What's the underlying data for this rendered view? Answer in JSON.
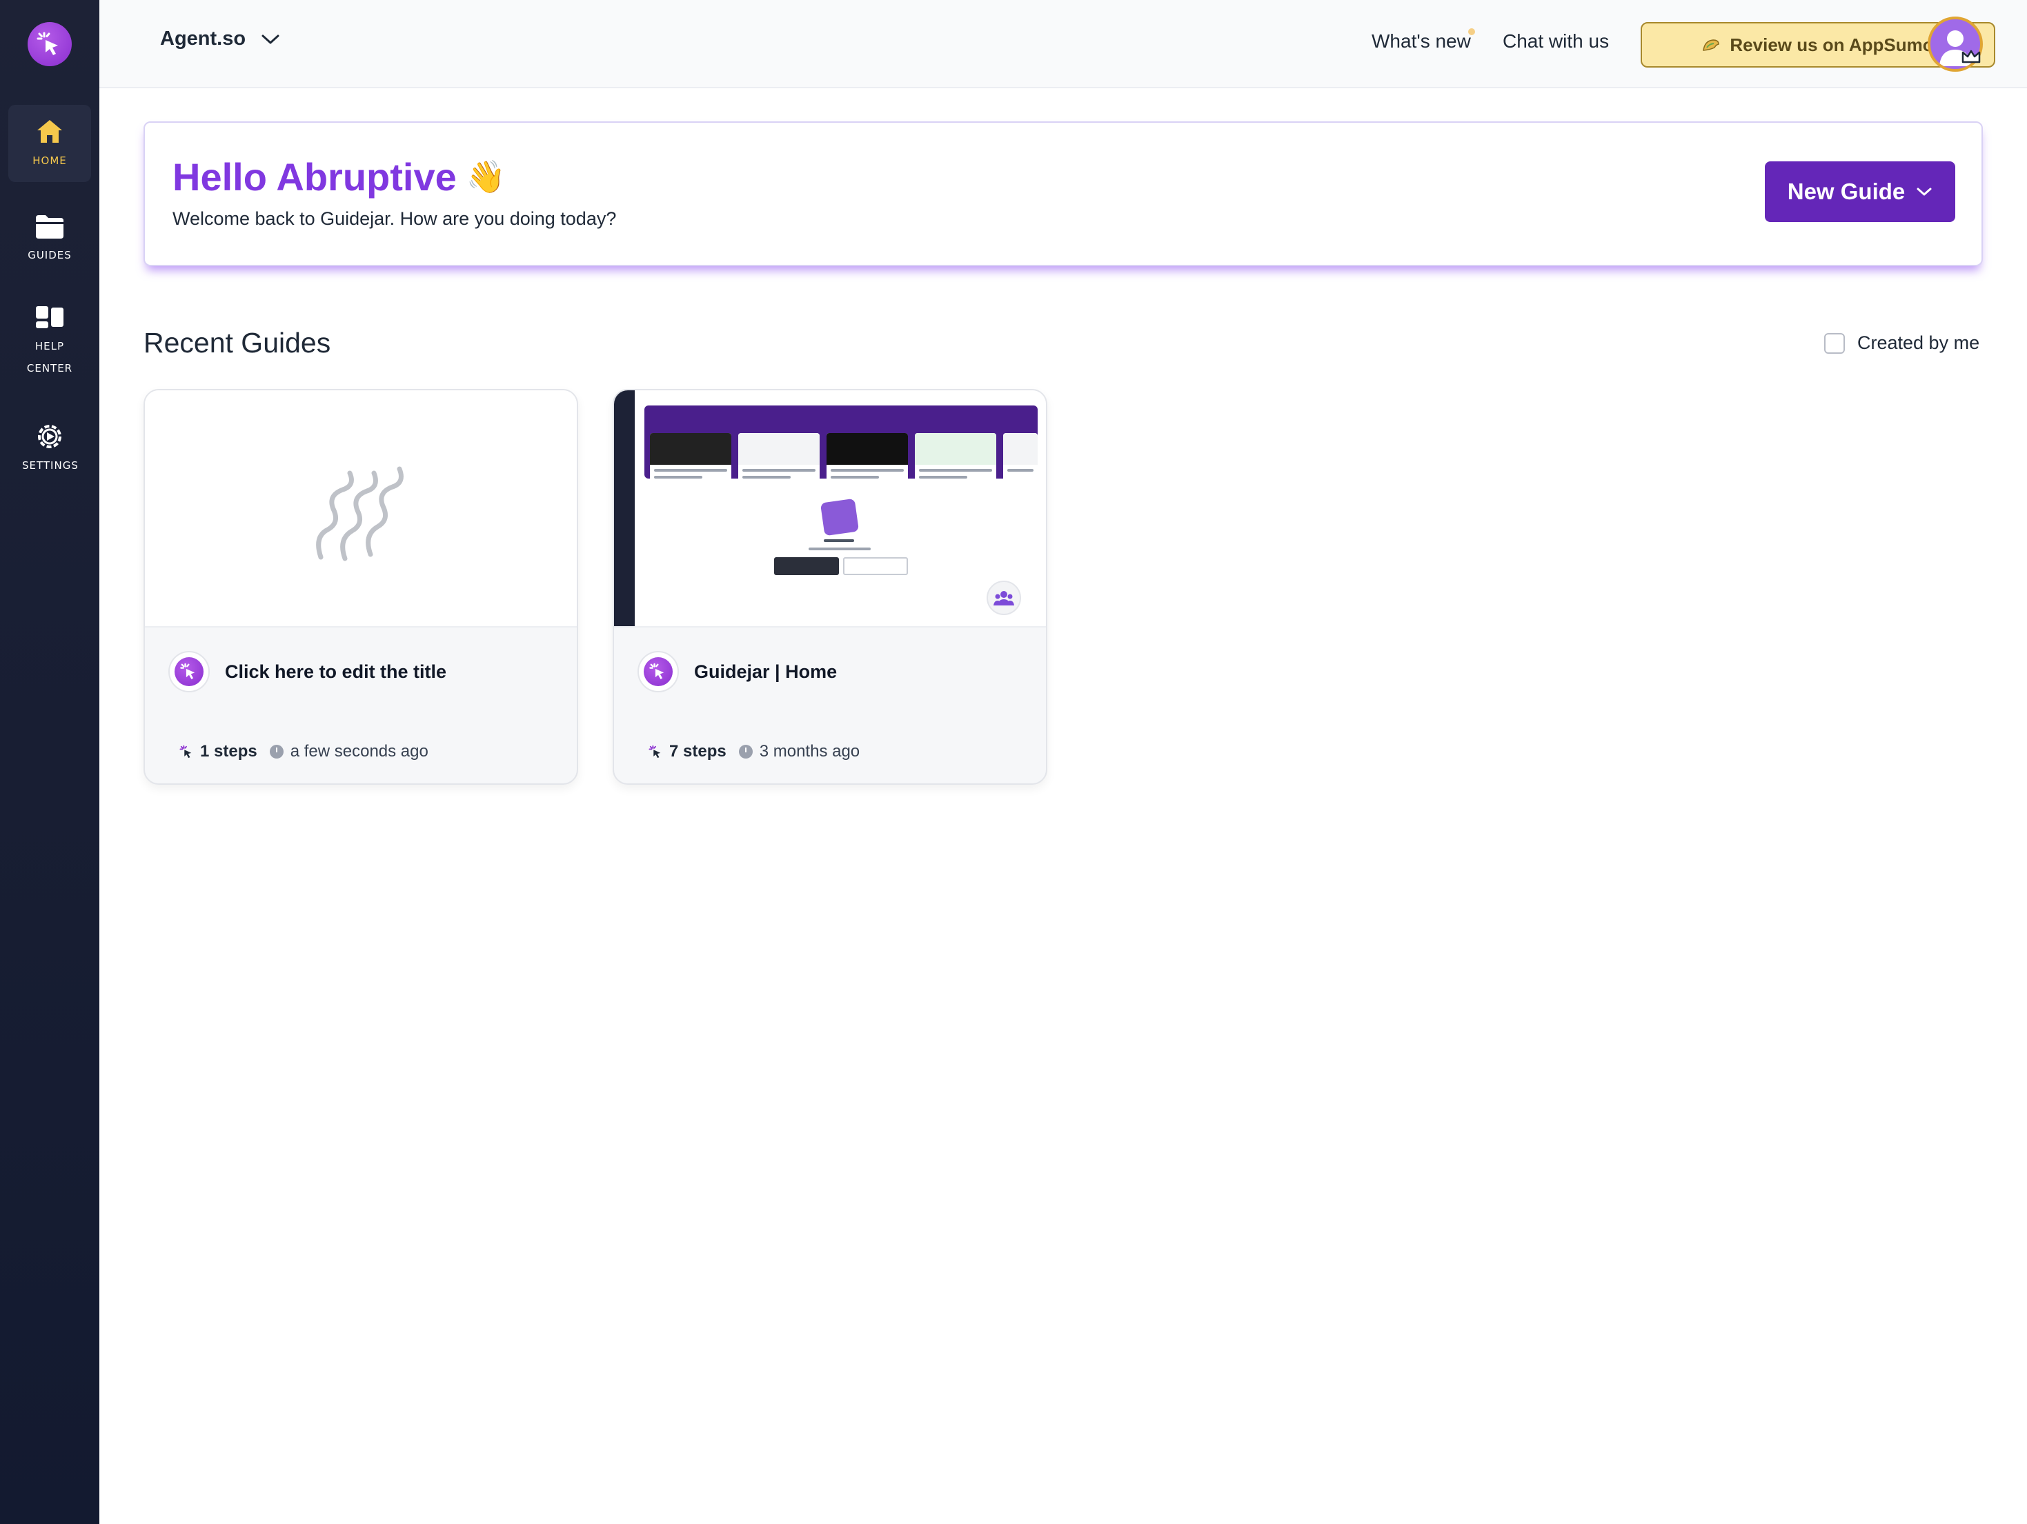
{
  "sidebar": {
    "items": [
      {
        "label": "HOME",
        "icon": "home-icon",
        "active": true
      },
      {
        "label": "GUIDES",
        "icon": "folder-icon",
        "active": false
      },
      {
        "label": "HELP CENTER",
        "icon": "help-center-icon",
        "active": false
      },
      {
        "label": "SETTINGS",
        "icon": "gear-icon",
        "active": false
      }
    ]
  },
  "header": {
    "workspace": "Agent.so",
    "whats_new": "What's new",
    "chat": "Chat with us",
    "review": "Review us on AppSumo"
  },
  "hello": {
    "title": "Hello Abruptive",
    "emoji": "👋",
    "subtitle": "Welcome back to Guidejar. How are you doing today?",
    "new_guide": "New Guide"
  },
  "recent": {
    "title": "Recent Guides",
    "filter_label": "Created by me",
    "cards": [
      {
        "title": "Click here to edit the title",
        "steps": "1 steps",
        "time": "a few seconds ago"
      },
      {
        "title": "Guidejar | Home",
        "steps": "7 steps",
        "time": "3 months ago"
      }
    ]
  },
  "colors": {
    "brand_purple": "#6426b8",
    "heading_purple": "#8038e0",
    "sidebar_bg": "#1d2236",
    "active_accent": "#f5c84c",
    "review_bg": "#fbe8a6"
  }
}
